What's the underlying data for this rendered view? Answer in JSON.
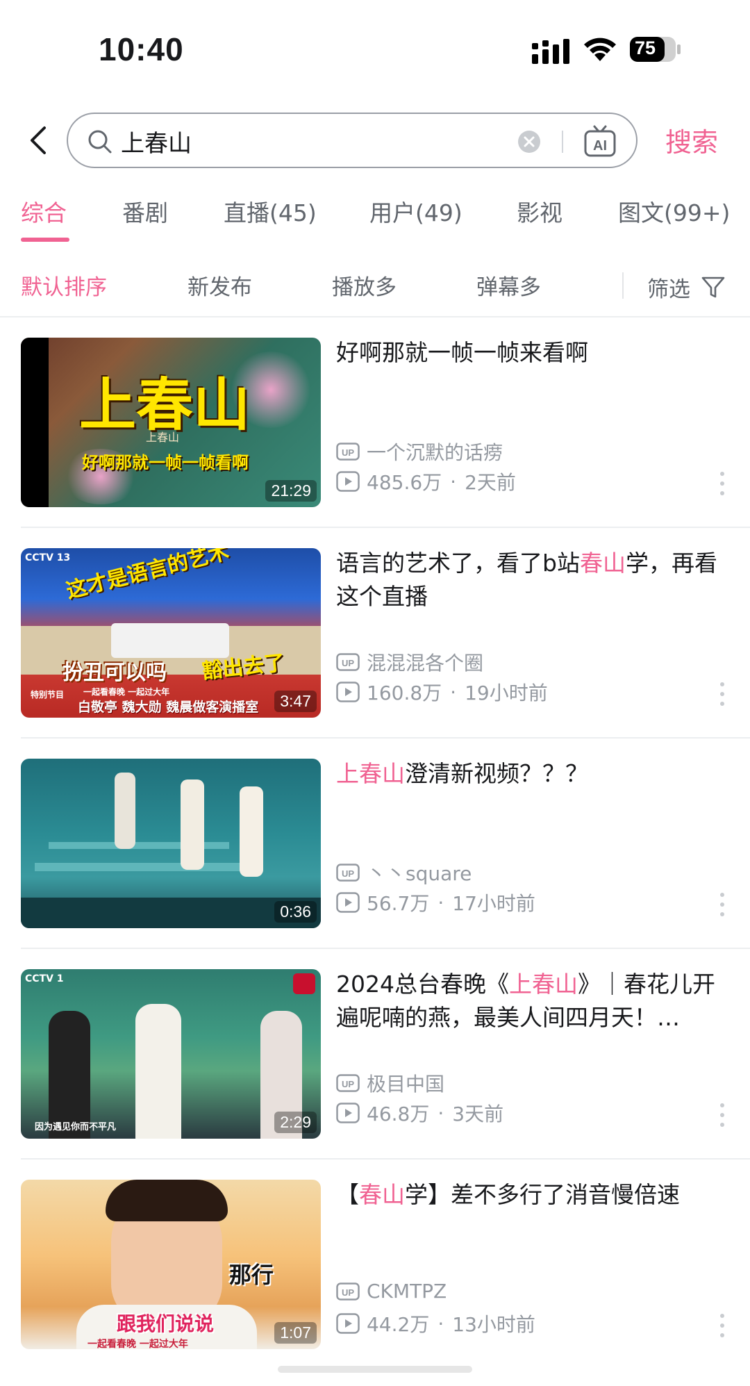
{
  "status_bar": {
    "time": "10:40",
    "battery": "75"
  },
  "search": {
    "query": "上春山",
    "button_label": "搜索"
  },
  "tabs": [
    {
      "label": "综合",
      "active": true
    },
    {
      "label": "番剧"
    },
    {
      "label": "直播(45)"
    },
    {
      "label": "用户(49)"
    },
    {
      "label": "影视"
    },
    {
      "label": "图文(99+)"
    }
  ],
  "sort": {
    "options": [
      "默认排序",
      "新发布",
      "播放多",
      "弹幕多"
    ],
    "filter_label": "筛选"
  },
  "colors": {
    "accent": "#f06292",
    "text": "#18191c",
    "meta": "#9499a0"
  },
  "videos": [
    {
      "title_parts": [
        {
          "text": "好啊那就一帧一帧来看啊"
        }
      ],
      "uploader": "一个沉默的话痨",
      "views": "485.6万",
      "time_ago": "2天前",
      "duration": "21:29",
      "thumb_text": [
        "上春山",
        "上春山",
        "好啊那就一帧一帧看啊"
      ]
    },
    {
      "title_parts": [
        {
          "text": "语言的艺术了，看了b站"
        },
        {
          "text": "春山",
          "hl": true
        },
        {
          "text": "学，再看这个直播"
        }
      ],
      "uploader": "混混混各个圈",
      "views": "160.8万",
      "time_ago": "19小时前",
      "duration": "3:47",
      "thumb_text": [
        "这才是语言的艺术",
        "扮丑可以吗",
        "豁出去了",
        "白敬亭 魏大勋 魏晨做客演播室",
        "CCTV 13",
        "特别节目",
        "一起看春晚 一起过大年"
      ]
    },
    {
      "title_parts": [
        {
          "text": "上春山",
          "hl": true
        },
        {
          "text": "澄清新视频？？？"
        }
      ],
      "uploader": "丶丶square",
      "views": "56.7万",
      "time_ago": "17小时前",
      "duration": "0:36",
      "thumb_text": []
    },
    {
      "title_parts": [
        {
          "text": "2024总台春晚《"
        },
        {
          "text": "上春山",
          "hl": true
        },
        {
          "text": "》｜春花儿开遍呢喃的燕，最美人间四月天！…"
        }
      ],
      "uploader": "极目中国",
      "views": "46.8万",
      "time_ago": "3天前",
      "duration": "2:29",
      "thumb_text": [
        "CCTV 1",
        "因为遇见你而不平凡"
      ]
    },
    {
      "title_parts": [
        {
          "text": "【"
        },
        {
          "text": "春山",
          "hl": true
        },
        {
          "text": "学】差不多行了消音慢倍速"
        }
      ],
      "uploader": "CKMTPZ",
      "views": "44.2万",
      "time_ago": "13小时前",
      "duration": "1:07",
      "thumb_text": [
        "那行",
        "跟我们说说",
        "一起看春晚 一起过大年"
      ]
    }
  ]
}
